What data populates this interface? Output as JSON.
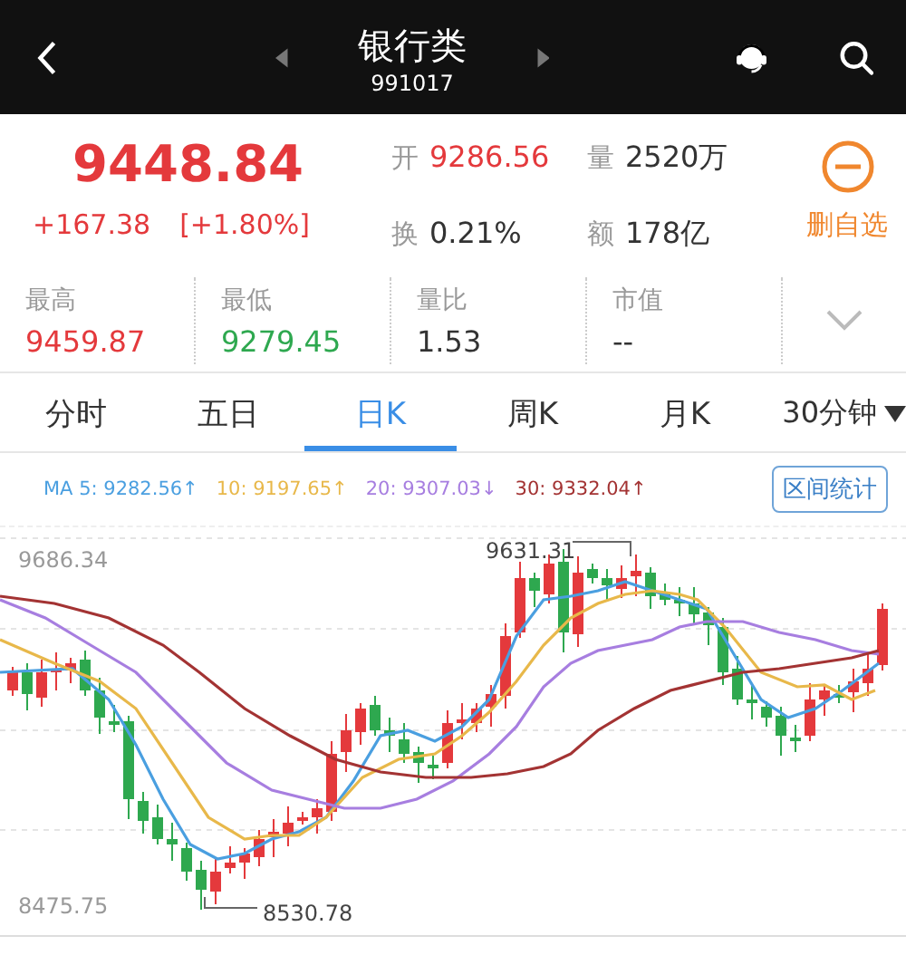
{
  "header": {
    "title": "银行类",
    "code": "991017"
  },
  "quote": {
    "price": "9448.84",
    "change": "+167.38",
    "change_pct": "[+1.80%]",
    "watch_action": "删自选",
    "details": [
      {
        "label": "开",
        "value": "9286.56",
        "color": "#e4393c"
      },
      {
        "label": "量",
        "value": "2520万",
        "color": "#333333"
      },
      {
        "label": "换",
        "value": "0.21%",
        "color": "#333333"
      },
      {
        "label": "额",
        "value": "178亿",
        "color": "#333333"
      }
    ]
  },
  "stats": [
    {
      "label": "最高",
      "value": "9459.87",
      "color": "#e4393c"
    },
    {
      "label": "最低",
      "value": "9279.45",
      "color": "#2ea84f"
    },
    {
      "label": "量比",
      "value": "1.53",
      "color": "#333333"
    },
    {
      "label": "市值",
      "value": "--",
      "color": "#333333"
    }
  ],
  "tabs": [
    {
      "label": "分时",
      "selected": false,
      "kind": "tab"
    },
    {
      "label": "五日",
      "selected": false,
      "kind": "tab"
    },
    {
      "label": "日K",
      "selected": true,
      "kind": "tab"
    },
    {
      "label": "周K",
      "selected": false,
      "kind": "tab"
    },
    {
      "label": "月K",
      "selected": false,
      "kind": "tab"
    },
    {
      "label": "30分钟",
      "selected": false,
      "kind": "dropdown"
    }
  ],
  "ma_legend": [
    {
      "label": "MA 5: 9282.56↑",
      "color": "#4a9fe0"
    },
    {
      "label": "10: 9197.65↑",
      "color": "#e8b84a"
    },
    {
      "label": "20: 9307.03↓",
      "color": "#a77ee0"
    },
    {
      "label": "30: 9332.04↑",
      "color": "#a33333"
    }
  ],
  "range_stats_button": "区间统计",
  "chart": {
    "y_max_label": "9686.34",
    "y_min_label": "8475.75",
    "high_label": "9631.31",
    "low_label": "8530.78"
  }
}
